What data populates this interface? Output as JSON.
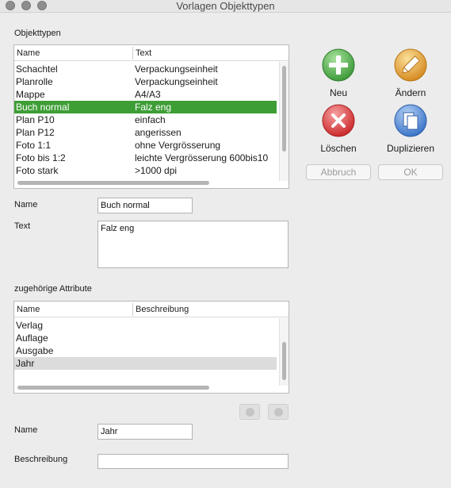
{
  "window": {
    "title": "Vorlagen Objekttypen"
  },
  "objekttypen": {
    "section_label": "Objekttypen",
    "columns": [
      "Name",
      "Text"
    ],
    "rows": [
      {
        "name": "Schachtel",
        "text": "Verpackungseinheit"
      },
      {
        "name": "Planrolle",
        "text": "Verpackungseinheit"
      },
      {
        "name": "Mappe",
        "text": "A4/A3"
      },
      {
        "name": "Buch normal",
        "text": "Falz eng",
        "selected": true
      },
      {
        "name": "Plan P10",
        "text": "einfach"
      },
      {
        "name": "Plan P12",
        "text": "angerissen"
      },
      {
        "name": "Foto 1:1",
        "text": "ohne Vergrösserung"
      },
      {
        "name": "Foto bis 1:2",
        "text": "leichte Vergrösserung 600bis10"
      },
      {
        "name": "Foto stark",
        "text": ">1000 dpi"
      }
    ]
  },
  "form": {
    "name_label": "Name",
    "name_value": "Buch normal",
    "text_label": "Text",
    "text_value": "Falz eng"
  },
  "attribute": {
    "section_label": "zugehörige Attribute",
    "columns": [
      "Name",
      "Beschreibung"
    ],
    "rows": [
      {
        "name": "Verlag",
        "desc": ""
      },
      {
        "name": "Auflage",
        "desc": ""
      },
      {
        "name": "Ausgabe",
        "desc": ""
      },
      {
        "name": "Jahr",
        "desc": "",
        "selected": true
      }
    ],
    "name_label": "Name",
    "name_value": "Jahr",
    "desc_label": "Beschreibung",
    "desc_value": ""
  },
  "actions": {
    "neu": "Neu",
    "aendern": "Ändern",
    "loeschen": "Löschen",
    "duplizieren": "Duplizieren",
    "abbruch": "Abbruch",
    "ok": "OK"
  },
  "colors": {
    "selection": "#3e9e36",
    "neu": "#4caf4a",
    "loeschen": "#e0393b",
    "aendern": "#e8a53a",
    "duplizieren": "#4a86d8"
  }
}
